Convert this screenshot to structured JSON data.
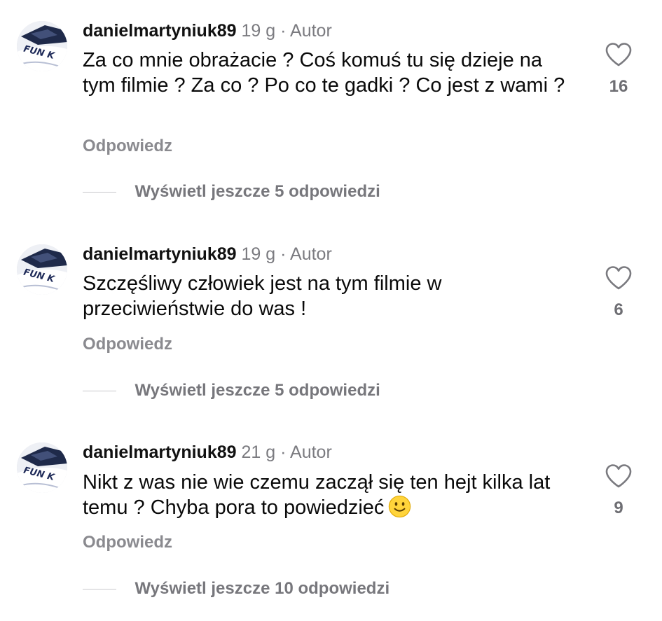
{
  "comments": [
    {
      "username": "danielmartyniuk89",
      "time": "19 g",
      "separator": "·",
      "badge": "Autor",
      "text": "Za co mnie obrażacie ? Coś komuś tu się dzieje na tym filmie ? Za co ? Po co te gadki ?  Co jest z wami ?",
      "likes": "16",
      "reply_label": "Odpowiedz",
      "more_replies_label": "Wyświetl jeszcze 5 odpowiedzi",
      "avatar_text": "FUN K",
      "like_icon": "heart-outline-icon"
    },
    {
      "username": "danielmartyniuk89",
      "time": "19 g",
      "separator": "·",
      "badge": "Autor",
      "text": "Szczęśliwy człowiek jest na tym filmie w przeciwieństwie do was !",
      "likes": "6",
      "reply_label": "Odpowiedz",
      "more_replies_label": "Wyświetl jeszcze 5 odpowiedzi",
      "avatar_text": "FUN K",
      "like_icon": "heart-outline-icon"
    },
    {
      "username": "danielmartyniuk89",
      "time": "21 g",
      "separator": "·",
      "badge": "Autor",
      "text": "Nikt z was nie wie czemu zaczął się ten hejt kilka lat temu ? Chyba pora to powiedzieć",
      "text_emoji": "slightly-smiling-face-emoji",
      "likes": "9",
      "reply_label": "Odpowiedz",
      "more_replies_label": "Wyświetl jeszcze 10 odpowiedzi",
      "avatar_text": "FUN K",
      "like_icon": "heart-outline-icon"
    }
  ],
  "colors": {
    "username": "#111111",
    "meta": "#7b7b80",
    "secondary_action": "#8a8a8f",
    "emoji_fill": "#ffd43b"
  }
}
